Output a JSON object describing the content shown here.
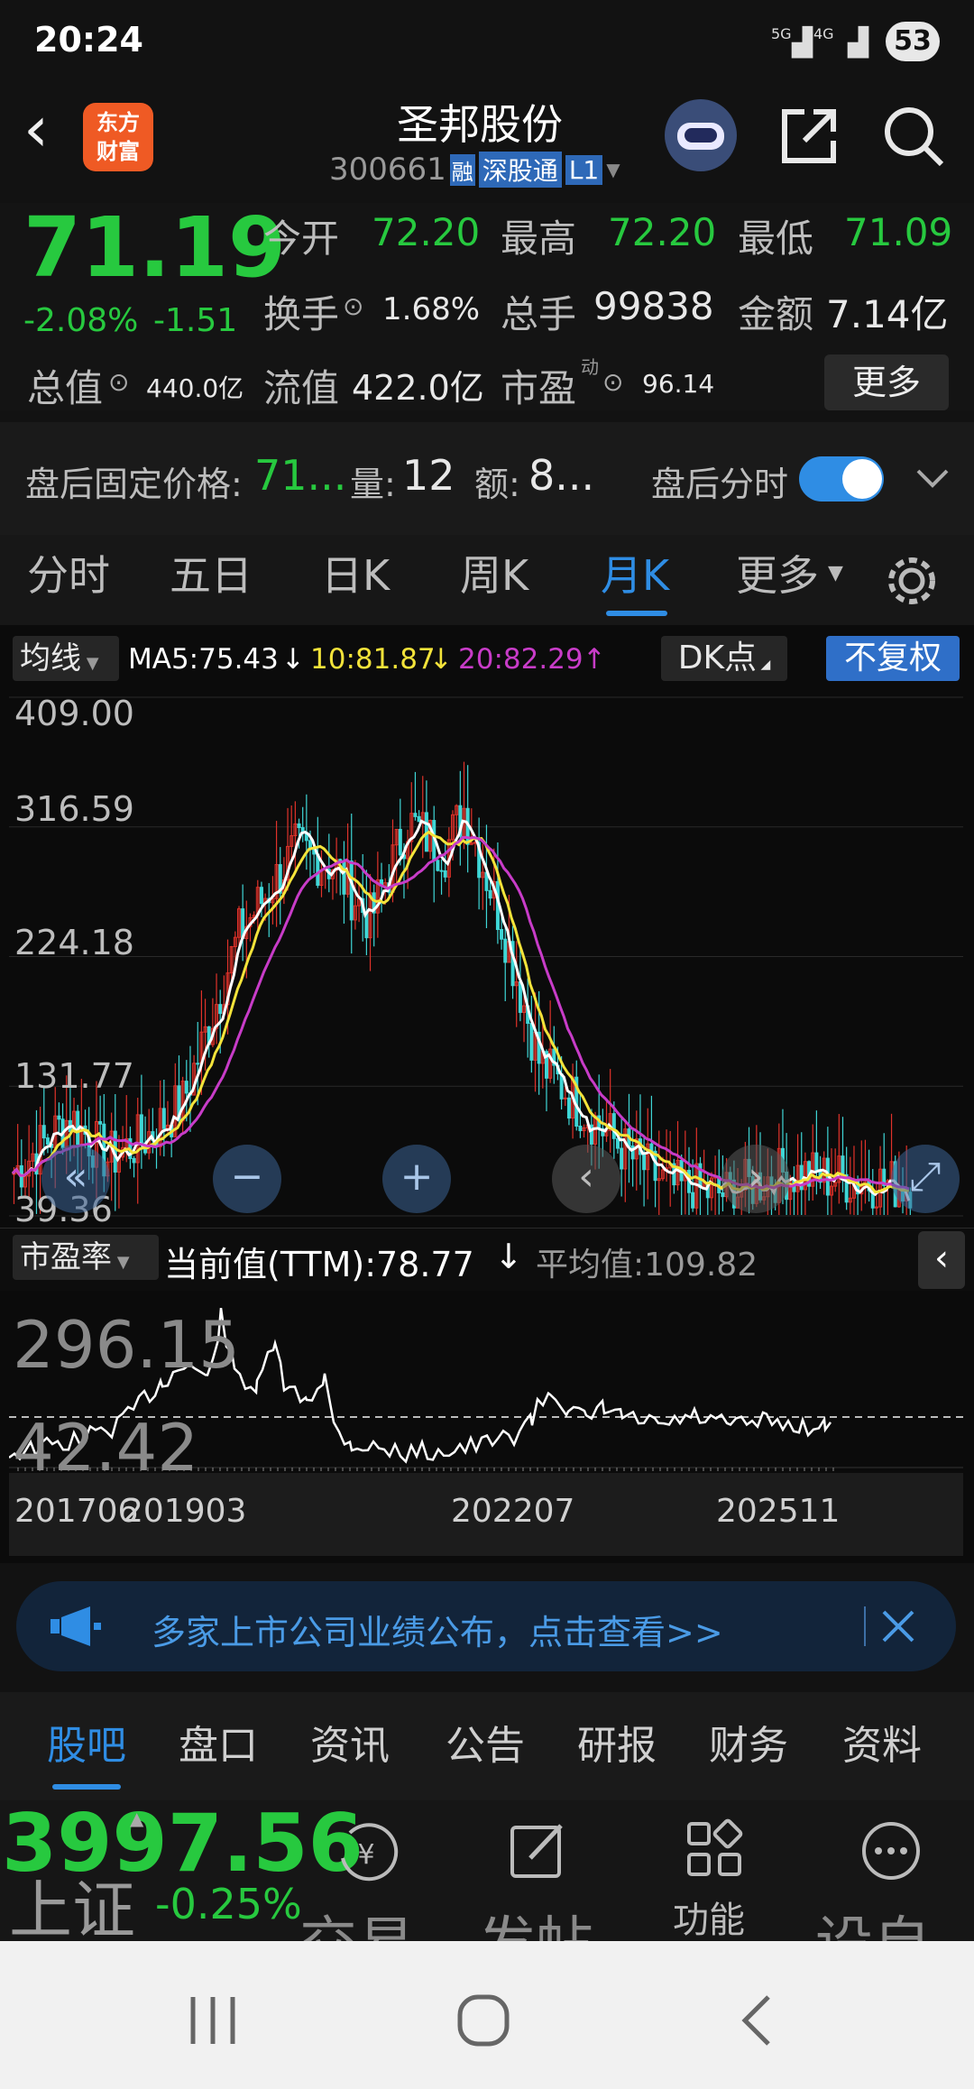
{
  "status": {
    "time": "20:24",
    "net1": "5G",
    "net2": "4G",
    "battery": "53"
  },
  "header": {
    "title": "圣邦股份",
    "code": "300661",
    "badge_rong": "融",
    "badge_sgt": "深股通",
    "badge_l1": "L1",
    "logo_line1": "东方",
    "logo_line2": "财富"
  },
  "quote": {
    "price": "71.19",
    "pct": "-2.08%",
    "chg": "-1.51",
    "open_label": "今开",
    "open": "72.20",
    "high_label": "最高",
    "high": "72.20",
    "low_label": "最低",
    "low": "71.09",
    "turn_label": "换手",
    "turn": "1.68%",
    "vol_label": "总手",
    "vol": "99838",
    "amt_label": "金额",
    "amt": "7.14亿",
    "mcap_label": "总值",
    "mcap": "440.0亿",
    "float_label": "流值",
    "float": "422.0亿",
    "pe_label": "市盈",
    "pe_sup": "动",
    "pe": "96.14",
    "more": "更多"
  },
  "after": {
    "label": "盘后固定价格:",
    "price": "71...",
    "vol_label": "量:",
    "vol": "12",
    "amt_label": "额:",
    "amt": "8...",
    "toggle_label": "盘后分时"
  },
  "tabs": [
    "分时",
    "五日",
    "日K",
    "周K",
    "月K",
    "更多"
  ],
  "ma": {
    "selector": "均线",
    "ma5": "MA5:75.43",
    "ma10": "10:81.87",
    "ma20": "20:82.29",
    "dk": "DK点",
    "fq": "不复权"
  },
  "axis": [
    "409.00",
    "316.59",
    "224.18",
    "131.77",
    "39.36"
  ],
  "pe_panel": {
    "selector": "市盈率",
    "current": "当前值(TTM):78.77",
    "avg": "平均值:109.82",
    "top": "296.15",
    "bottom": "42.42"
  },
  "dates": [
    "201706",
    "201903",
    "202207",
    "202511"
  ],
  "banner": {
    "text": "多家上市公司业绩公布，点击查看>>"
  },
  "bottom_tabs": [
    "股吧",
    "盘口",
    "资讯",
    "公告",
    "研报",
    "财务",
    "资料"
  ],
  "footer": {
    "index_value": "3997.56",
    "index_name": "上证",
    "index_pct": "-0.25%",
    "trade": "交易",
    "post": "发帖",
    "func": "功能",
    "watch": "设自"
  },
  "colors": {
    "green": "#27c93f",
    "yellow": "#f3e33a",
    "magenta": "#c83cc8",
    "red": "#e0322a",
    "cyan": "#3fd6d6",
    "accent": "#2f8de4"
  },
  "chart_data": {
    "type": "candlestick",
    "title": "",
    "period": "monthly",
    "ylim": [
      39.36,
      409.0
    ],
    "yticks": [
      409.0,
      316.59,
      224.18,
      131.77,
      39.36
    ],
    "ma": {
      "MA5": 75.43,
      "MA10": 81.87,
      "MA20": 82.29
    },
    "x_labels": [
      "201706",
      "201903",
      "202207",
      "202511"
    ],
    "pe_ttm": {
      "current": 78.77,
      "average": 109.82,
      "max_label": 296.15,
      "min_label": 42.42
    }
  }
}
